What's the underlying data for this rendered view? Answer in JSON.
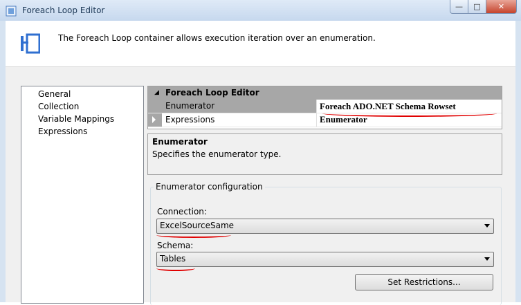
{
  "window": {
    "title": "Foreach Loop Editor",
    "buttons": {
      "minimize": "—",
      "maximize": "□",
      "close": "✕"
    }
  },
  "header": {
    "description": "The Foreach Loop container allows execution iteration over an enumeration.",
    "icon": "foreach-loop-icon"
  },
  "nav": {
    "items": [
      {
        "label": "General"
      },
      {
        "label": "Collection"
      },
      {
        "label": "Variable Mappings"
      },
      {
        "label": "Expressions"
      }
    ]
  },
  "grid": {
    "category": "Foreach Loop Editor",
    "rows": [
      {
        "name": "Enumerator",
        "value": "Foreach ADO.NET Schema Rowset Enumerator"
      },
      {
        "name": "Expressions",
        "value": ""
      }
    ]
  },
  "description_panel": {
    "title": "Enumerator",
    "text": "Specifies the enumerator type."
  },
  "config": {
    "title": "Enumerator configuration",
    "connection_label": "Connection:",
    "connection_value": "ExcelSourceSame",
    "schema_label": "Schema:",
    "schema_value": "Tables",
    "set_restrictions_label": "Set Restrictions..."
  },
  "colors": {
    "annotation_red": "#e00000",
    "category_gray": "#a7a7a7",
    "frame_blue": "#d6e3f1"
  }
}
